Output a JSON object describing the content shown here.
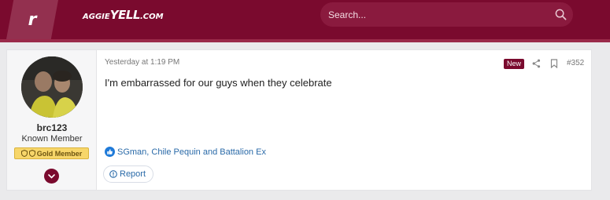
{
  "header": {
    "logo_letter": "r",
    "wordmark_prefix": "AGGIE",
    "wordmark_main": "YELL",
    "wordmark_suffix": ".COM",
    "search_placeholder": "Search..."
  },
  "post": {
    "author": {
      "username": "brc123",
      "title": "Known Member",
      "badge": "Gold Member"
    },
    "timestamp": "Yesterday at 1:19 PM",
    "new_label": "New",
    "post_number": "#352",
    "message": "I'm embarrassed for our guys when they celebrate",
    "reactions_text": "SGman, Chile Pequin and Battalion Ex",
    "report_label": "Report"
  },
  "colors": {
    "brand": "#7a0a2e",
    "link": "#2a6aa8",
    "badge_gold": "#f7d66a"
  },
  "icons": [
    "search-icon",
    "share-icon",
    "bookmark-icon",
    "like-icon",
    "report-icon",
    "chevron-down-icon",
    "shield-icon"
  ]
}
